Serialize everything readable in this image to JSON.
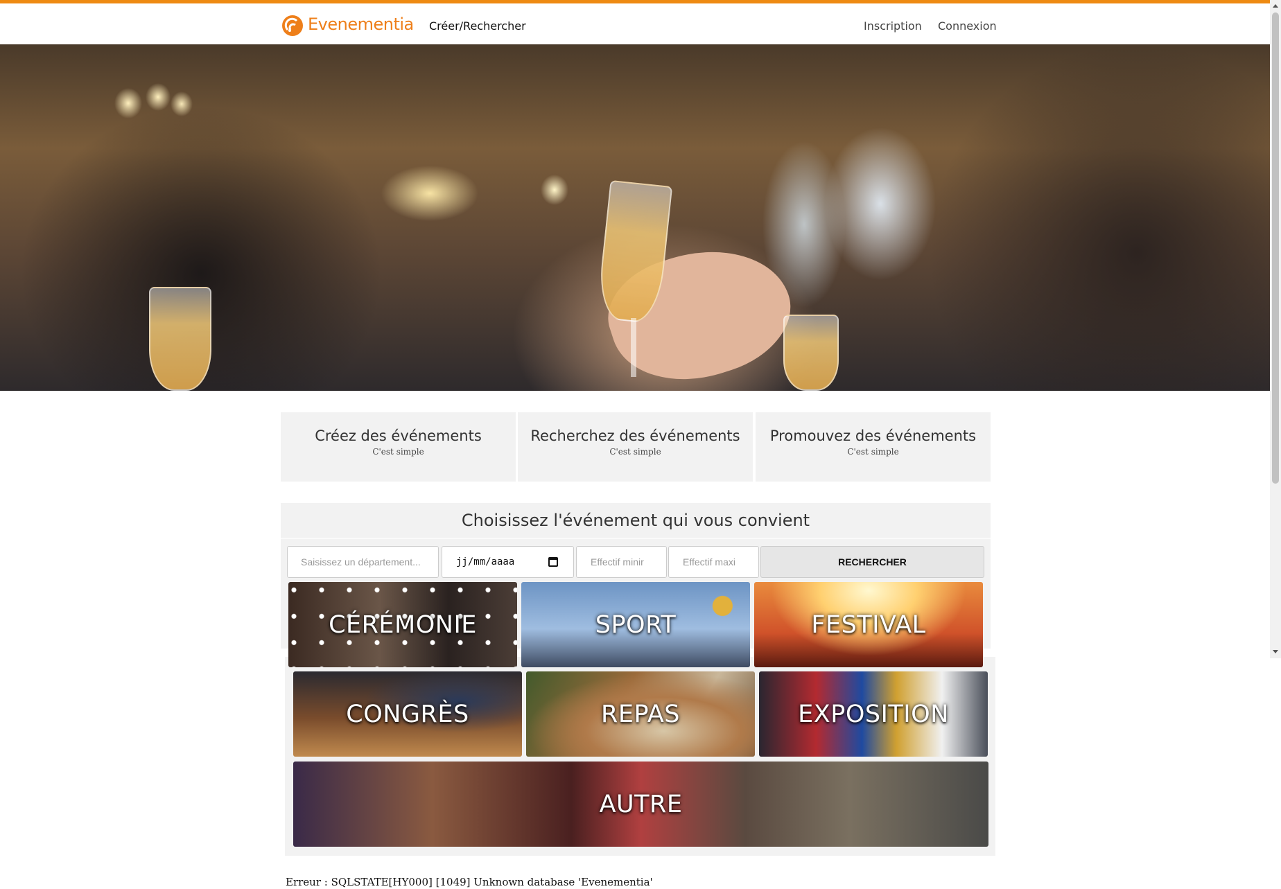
{
  "header": {
    "logo_text": "Evenementia",
    "nav_create": "Créer/Rechercher",
    "nav_inscription": "Inscription",
    "nav_connexion": "Connexion"
  },
  "features": [
    {
      "title": "Créez des événements",
      "subtitle": "C'est simple"
    },
    {
      "title": "Recherchez des événements",
      "subtitle": "C'est simple"
    },
    {
      "title": "Promouvez des événements",
      "subtitle": "C'est simple"
    }
  ],
  "search": {
    "title": "Choisissez l'événement qui vous convient",
    "department_placeholder": "Saisissez un département...",
    "date_value": "jj/mm/aaaa",
    "min_placeholder": "Effectif minir",
    "max_placeholder": "Effectif maxi",
    "button_label": "RECHERCHER"
  },
  "categories": [
    "CÉRÉMONIE",
    "SPORT",
    "FESTIVAL",
    "CONGRÈS",
    "REPAS",
    "EXPOSITION",
    "AUTRE"
  ],
  "error_message": "Erreur : SQLSTATE[HY000] [1049] Unknown database 'Evenementia'",
  "colors": {
    "accent": "#ee8a12",
    "panel": "#f2f2f2"
  }
}
